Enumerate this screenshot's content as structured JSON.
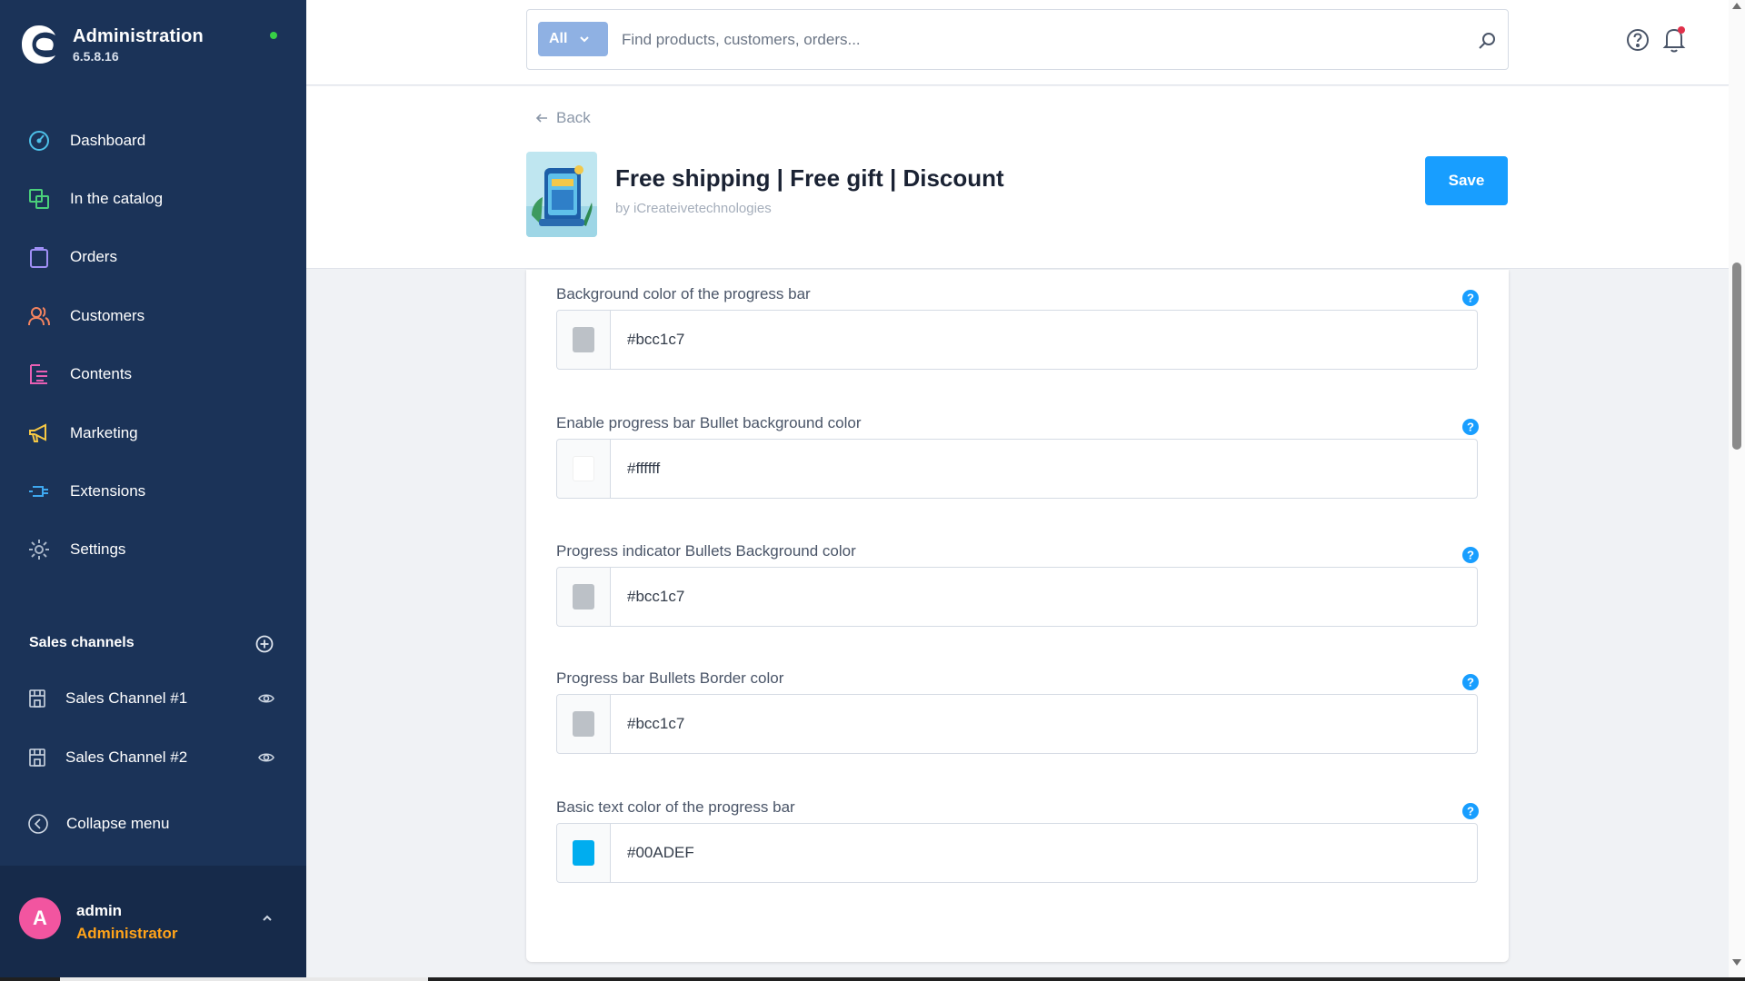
{
  "app": {
    "title": "Administration",
    "version": "6.5.8.16"
  },
  "sidebar": {
    "items": [
      {
        "label": "Dashboard",
        "icon": "dashboard-icon",
        "color": "#4dc0e8"
      },
      {
        "label": "In the catalog",
        "icon": "catalog-icon",
        "color": "#4ad07a"
      },
      {
        "label": "Orders",
        "icon": "orders-icon",
        "color": "#9f8ff5"
      },
      {
        "label": "Customers",
        "icon": "customers-icon",
        "color": "#f4845f"
      },
      {
        "label": "Contents",
        "icon": "contents-icon",
        "color": "#e85fb4"
      },
      {
        "label": "Marketing",
        "icon": "marketing-icon",
        "color": "#f6c844"
      },
      {
        "label": "Extensions",
        "icon": "extensions-icon",
        "color": "#3ea8f0"
      },
      {
        "label": "Settings",
        "icon": "settings-icon",
        "color": "#a9b6c8"
      }
    ],
    "sales_channels_title": "Sales channels",
    "channels": [
      {
        "label": "Sales Channel #1"
      },
      {
        "label": "Sales Channel #2"
      }
    ],
    "collapse_label": "Collapse menu",
    "user": {
      "initial": "A",
      "name": "admin",
      "role": "Administrator"
    }
  },
  "search": {
    "scope": "All",
    "placeholder": "Find products, customers, orders..."
  },
  "header": {
    "back_label": "Back",
    "plugin_title": "Free shipping | Free gift | Discount",
    "plugin_by": "by iCreateivetechnologies",
    "save_label": "Save"
  },
  "fields": [
    {
      "label": "Background color of the progress bar",
      "value": "#bcc1c7",
      "swatch": "#bcc1c7"
    },
    {
      "label": "Enable progress bar Bullet background color",
      "value": "#ffffff",
      "swatch": "#ffffff"
    },
    {
      "label": "Progress indicator Bullets Background color",
      "value": "#bcc1c7",
      "swatch": "#bcc1c7"
    },
    {
      "label": "Progress bar Bullets Border color",
      "value": "#bcc1c7",
      "swatch": "#bcc1c7"
    },
    {
      "label": "Basic text color of the progress bar",
      "value": "#00ADEF",
      "swatch": "#00ADEF"
    }
  ],
  "colors": {
    "sidebar_bg": "#1b3358",
    "accent": "#189eff",
    "help": "#189eff"
  }
}
